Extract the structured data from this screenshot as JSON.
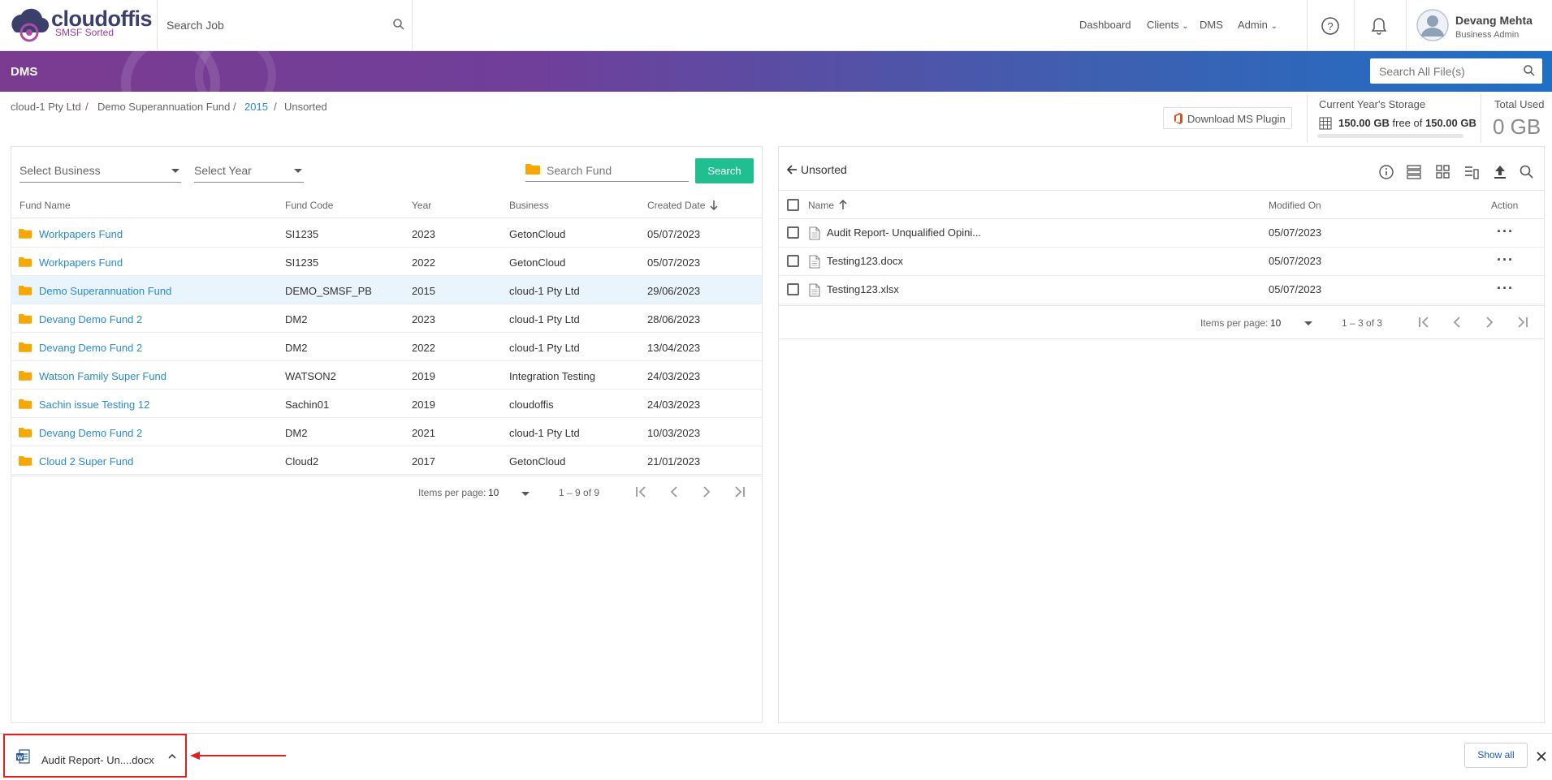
{
  "header": {
    "logo_text": "cloudoffis",
    "logo_sub": "SMSF Sorted",
    "search_placeholder": "Search Job",
    "nav": [
      "Dashboard",
      "Clients",
      "DMS",
      "Admin"
    ],
    "user_name": "Devang Mehta",
    "user_role": "Business Admin"
  },
  "band": {
    "title": "DMS",
    "search_placeholder": "Search All File(s)"
  },
  "breadcrumb": [
    "cloud-1 Pty Ltd",
    "Demo Superannuation Fund",
    "2015",
    "Unsorted"
  ],
  "plugin_button": "Download MS Plugin",
  "storage": {
    "title": "Current Year's Storage",
    "free": "150.00 GB",
    "free_of": "free of",
    "total": "150.00 GB",
    "total_used_label": "Total Used",
    "total_used": "0 GB"
  },
  "left": {
    "select_business": "Select Business",
    "select_year": "Select Year",
    "search_fund_placeholder": "Search Fund",
    "search_button": "Search",
    "columns": [
      "Fund Name",
      "Fund Code",
      "Year",
      "Business",
      "Created Date"
    ],
    "rows": [
      {
        "name": "Workpapers Fund",
        "code": "SI1235",
        "year": "2023",
        "business": "GetonCloud",
        "date": "05/07/2023"
      },
      {
        "name": "Workpapers Fund",
        "code": "SI1235",
        "year": "2022",
        "business": "GetonCloud",
        "date": "05/07/2023"
      },
      {
        "name": "Demo Superannuation Fund",
        "code": "DEMO_SMSF_PB",
        "year": "2015",
        "business": "cloud-1 Pty Ltd",
        "date": "29/06/2023"
      },
      {
        "name": "Devang Demo Fund 2",
        "code": "DM2",
        "year": "2023",
        "business": "cloud-1 Pty Ltd",
        "date": "28/06/2023"
      },
      {
        "name": "Devang Demo Fund 2",
        "code": "DM2",
        "year": "2022",
        "business": "cloud-1 Pty Ltd",
        "date": "13/04/2023"
      },
      {
        "name": "Watson Family Super Fund",
        "code": "WATSON2",
        "year": "2019",
        "business": "Integration Testing",
        "date": "24/03/2023"
      },
      {
        "name": "Sachin issue Testing 12",
        "code": "Sachin01",
        "year": "2019",
        "business": "cloudoffis",
        "date": "24/03/2023"
      },
      {
        "name": "Devang Demo Fund 2",
        "code": "DM2",
        "year": "2021",
        "business": "cloud-1 Pty Ltd",
        "date": "10/03/2023"
      },
      {
        "name": "Cloud 2 Super Fund",
        "code": "Cloud2",
        "year": "2017",
        "business": "GetonCloud",
        "date": "21/01/2023"
      }
    ],
    "pager": {
      "label": "Items per page:",
      "value": "10",
      "range": "1 – 9 of 9"
    }
  },
  "right": {
    "title": "Unsorted",
    "columns": [
      "Name",
      "Modified On",
      "Action"
    ],
    "rows": [
      {
        "name": "Audit Report- Unqualified Opini...",
        "modified": "05/07/2023"
      },
      {
        "name": "Testing123.docx",
        "modified": "05/07/2023"
      },
      {
        "name": "Testing123.xlsx",
        "modified": "05/07/2023"
      }
    ],
    "pager": {
      "label": "Items per page:",
      "value": "10",
      "range": "1 – 3 of 3"
    }
  },
  "download": {
    "file": "Audit Report- Un....docx",
    "show_all": "Show all"
  }
}
